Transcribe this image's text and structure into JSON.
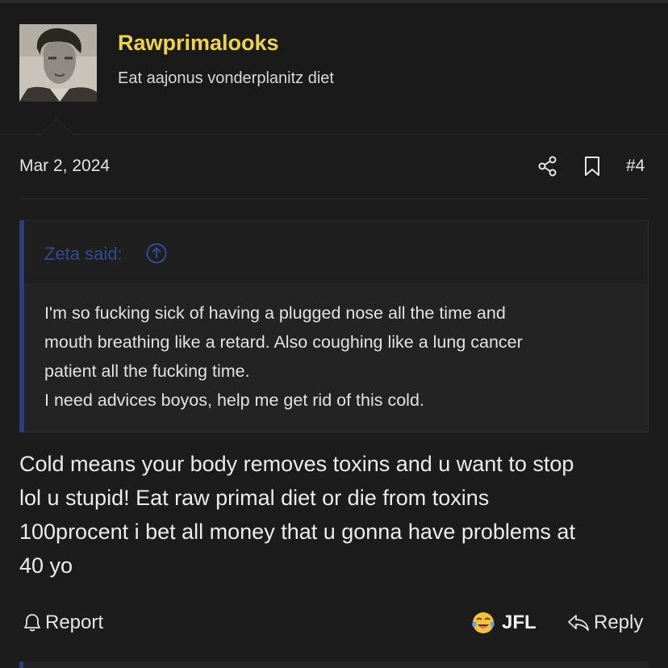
{
  "user": {
    "name": "Rawprimalooks",
    "title": "Eat aajonus vonderplanitz diet",
    "avatar_icon": "user-photo-avatar"
  },
  "post": {
    "date": "Mar 2, 2024",
    "number": "#4",
    "share_icon": "share-icon",
    "bookmark_icon": "bookmark-icon"
  },
  "quote": {
    "author": "Zeta said:",
    "jump_icon": "arrow-up-circle-icon",
    "lines": [
      "I'm so fucking sick of having a plugged nose all the time and",
      "mouth breathing like a retard. Also coughing like a lung cancer",
      "patient all the fucking time.",
      "I need advices boyos, help me get rid of this cold."
    ]
  },
  "message": {
    "lines": [
      "Cold means your body removes toxins and u want to stop",
      "lol u stupid! Eat raw primal diet or die from toxins",
      "100procent i bet all money that u gonna have problems at",
      "40 yo"
    ]
  },
  "actions": {
    "report_label": "Report",
    "reaction_label": "JFL",
    "reaction_icon": "crying-laughing-emoji",
    "reply_label": "Reply"
  },
  "colors": {
    "background": "#1c1c1c",
    "username": "#ecd44a",
    "quote_accent": "#2a3f7a",
    "quote_author": "#2f4c8f"
  }
}
